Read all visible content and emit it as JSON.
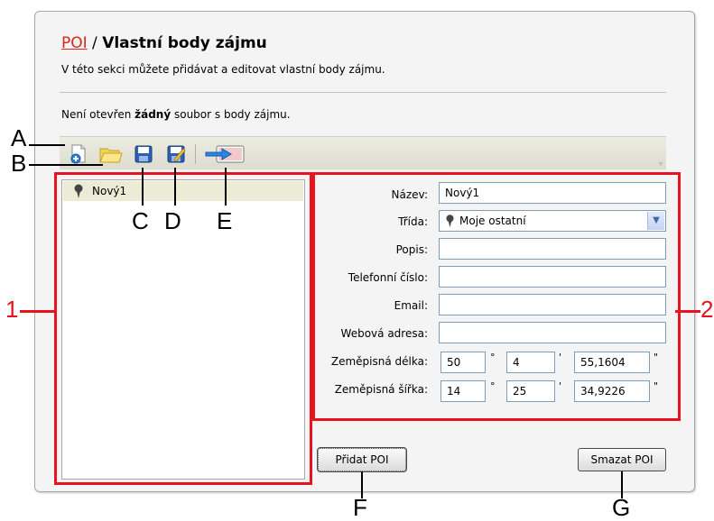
{
  "header": {
    "poi_link": "POI",
    "separator": " / ",
    "title": "Vlastní body zájmu",
    "subtitle": "V této sekci můžete přidávat a editovat vlastní body zájmu."
  },
  "status": {
    "prefix": "Není otevřen ",
    "bold": "žádný",
    "suffix": " soubor s body zájmu."
  },
  "toolbar": {
    "icons": [
      "new-file-icon",
      "open-folder-icon",
      "save-icon",
      "save-as-icon",
      "export-icon"
    ]
  },
  "tree": {
    "items": [
      {
        "label": "Nový1",
        "icon": "pin-icon"
      }
    ]
  },
  "form": {
    "name_label": "Název:",
    "name_value": "Nový1",
    "class_label": "Třída:",
    "class_value": "Moje ostatní",
    "desc_label": "Popis:",
    "desc_value": "",
    "phone_label": "Telefonní číslo:",
    "phone_value": "",
    "email_label": "Email:",
    "email_value": "",
    "web_label": "Webová adresa:",
    "web_value": "",
    "lon_label": "Zeměpisná délka:",
    "lon_deg": "50",
    "lon_min": "4",
    "lon_sec": "55,1604",
    "lat_label": "Zeměpisná šířka:",
    "lat_deg": "14",
    "lat_min": "25",
    "lat_sec": "34,9226",
    "deg_symbol": "°",
    "min_symbol": "'",
    "sec_symbol": "\""
  },
  "buttons": {
    "add": "Přidat POI",
    "delete": "Smazat POI"
  },
  "callouts": {
    "A": "A",
    "B": "B",
    "C": "C",
    "D": "D",
    "E": "E",
    "F": "F",
    "G": "G",
    "one": "1",
    "two": "2"
  },
  "colors": {
    "callout_red": "#e8131c",
    "poi_link": "#d8261c",
    "tree_selected": "#ecebd6"
  }
}
